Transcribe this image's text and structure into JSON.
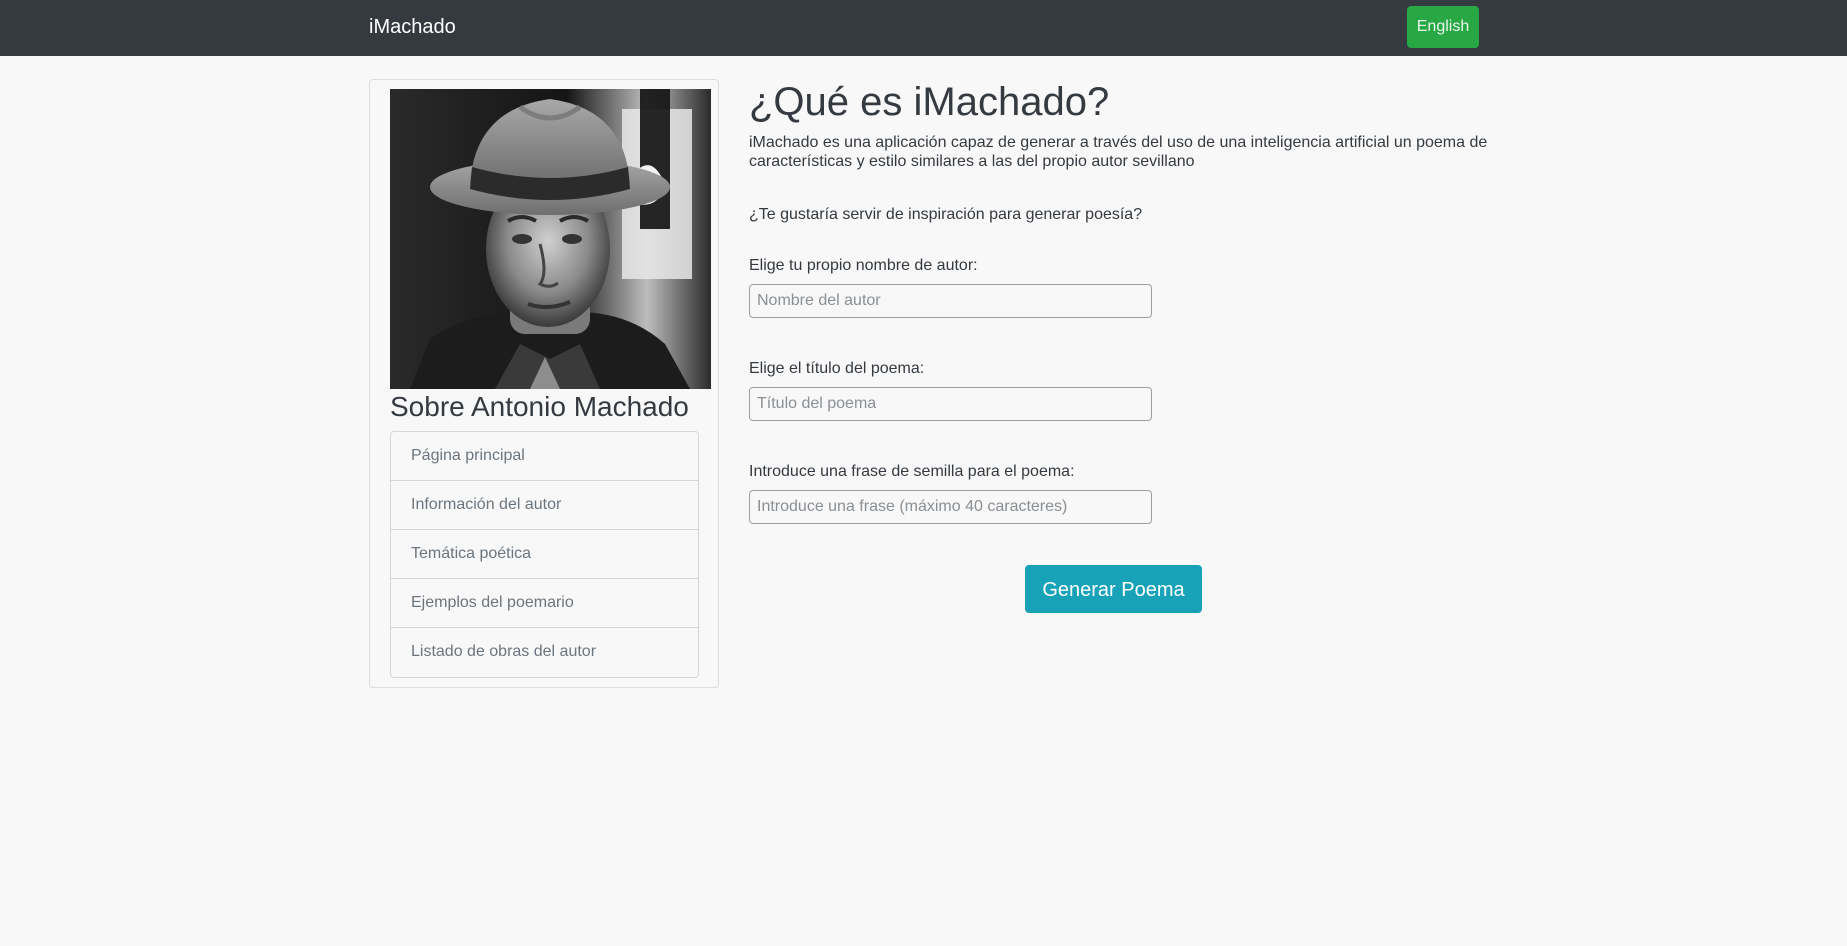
{
  "navbar": {
    "brand": "iMachado",
    "language_button": "English",
    "background_color": "#343a40",
    "language_button_color": "#28a745"
  },
  "sidebar": {
    "portrait_alt": "portrait-photo",
    "title": "Sobre Antonio Machado",
    "items": [
      {
        "label": "Página principal"
      },
      {
        "label": "Información del autor"
      },
      {
        "label": "Temática poética"
      },
      {
        "label": "Ejemplos del poemario"
      },
      {
        "label": "Listado de obras del autor"
      }
    ]
  },
  "main": {
    "title": "¿Qué es iMachado?",
    "intro": "iMachado es una aplicación capaz de generar a través del uso de una inteligencia artificial un poema de características y estilo similares a las del propio autor sevillano",
    "question": "¿Te gustaría servir de inspiración para generar poesía?",
    "form": {
      "author": {
        "label": "Elige tu propio nombre de autor:",
        "placeholder": "Nombre del autor",
        "value": ""
      },
      "title": {
        "label": "Elige el título del poema:",
        "placeholder": "Título del poema",
        "value": ""
      },
      "seed": {
        "label": "Introduce una frase de semilla para el poema:",
        "placeholder": "Introduce una frase (máximo 40 caracteres)",
        "value": ""
      },
      "submit_label": "Generar Poema",
      "submit_color": "#17a2b8"
    }
  }
}
